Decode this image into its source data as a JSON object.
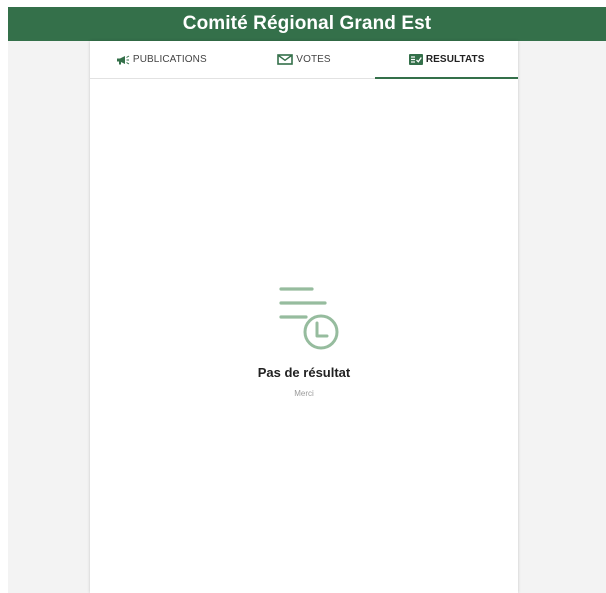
{
  "header": {
    "title": "Comité Régional Grand Est"
  },
  "tabs": [
    {
      "label": "PUBLICATIONS",
      "icon": "megaphone-icon",
      "active": false
    },
    {
      "label": "VOTES",
      "icon": "envelope-icon",
      "active": false
    },
    {
      "label": "RESULTATS",
      "icon": "results-icon",
      "active": true
    }
  ],
  "empty_state": {
    "icon": "list-clock-icon",
    "title": "Pas de résultat",
    "subtitle": "Merci"
  },
  "colors": {
    "brand_green": "#34704a",
    "icon_green": "#96bc9e",
    "background": "#f3f3f3"
  }
}
